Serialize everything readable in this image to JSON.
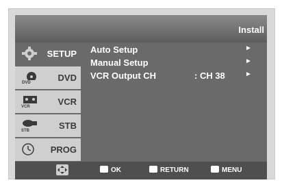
{
  "header": {
    "title": "Install"
  },
  "sidebar": {
    "items": [
      {
        "label": "SETUP",
        "icon": "gear-icon",
        "active": true
      },
      {
        "label": "DVD",
        "icon": "dvd-icon",
        "active": false
      },
      {
        "label": "VCR",
        "icon": "vcr-icon",
        "active": false
      },
      {
        "label": "STB",
        "icon": "stb-icon",
        "active": false
      },
      {
        "label": "PROG",
        "icon": "clock-icon",
        "active": false
      }
    ]
  },
  "menu": {
    "items": [
      {
        "label": "Auto Setup",
        "value": "",
        "arrow": "►"
      },
      {
        "label": "Manual Setup",
        "value": "",
        "arrow": "►"
      },
      {
        "label": "VCR Output CH",
        "value": ": CH 38",
        "arrow": "►"
      }
    ]
  },
  "footer": {
    "ok_label": "OK",
    "return_label": "RETURN",
    "menu_label": "MENU",
    "nav_icon": "dpad-icon",
    "ok_icon": "ok-icon",
    "return_icon": "return-icon",
    "menu_icon": "menu-icon"
  }
}
